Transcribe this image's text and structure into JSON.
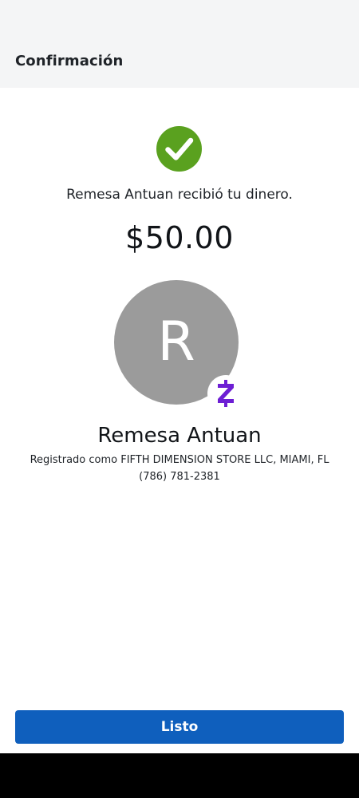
{
  "header": {
    "title": "Confirmación"
  },
  "confirmation": {
    "message": "Remesa Antuan recibió tu dinero.",
    "amount": "$50.00",
    "success_icon": "check-circle-icon",
    "success_color": "#5aa11f"
  },
  "recipient": {
    "avatar_initial": "R",
    "avatar_color": "#9b9b9b",
    "badge_icon": "zelle-icon",
    "badge_color": "#6d1ed4",
    "name": "Remesa Antuan",
    "registered_as": "Registrado como FIFTH DIMENSION STORE LLC, MIAMI, FL",
    "phone": "(786) 781-2381"
  },
  "actions": {
    "done_label": "Listo",
    "done_color": "#0f5fbd"
  }
}
